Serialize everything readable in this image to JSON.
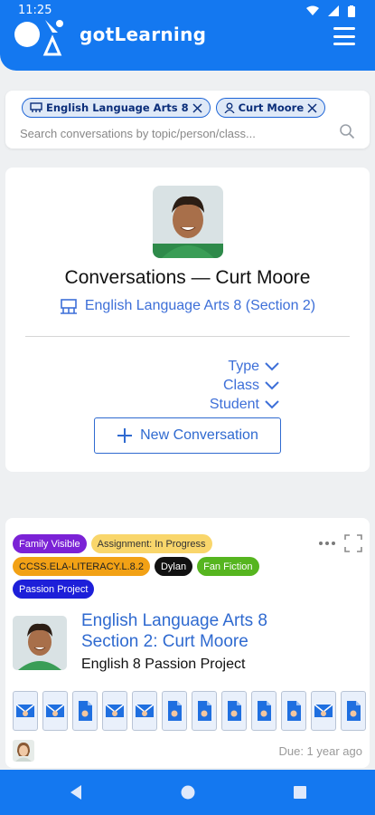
{
  "status_bar": {
    "time": "11:25"
  },
  "app": {
    "brand": "gotLearning"
  },
  "search": {
    "chips": [
      {
        "label": "English Language Arts 8",
        "icon": "classroom-icon"
      },
      {
        "label": "Curt Moore",
        "icon": "person-icon"
      }
    ],
    "placeholder": "Search conversations by topic/person/class..."
  },
  "header_card": {
    "title": "Conversations — Curt Moore",
    "class_link": "English Language Arts 8 (Section 2)",
    "filters": [
      "Type",
      "Class",
      "Student"
    ],
    "new_conversation_label": "New Conversation"
  },
  "conversation": {
    "tags": [
      {
        "label": "Family Visible",
        "bg": "#7b22d6",
        "fg": "#ffffff"
      },
      {
        "label": "Assignment: In Progress",
        "bg": "#f9d66b",
        "fg": "#333333"
      },
      {
        "label": "CCSS.ELA-LITERACY.L.8.2",
        "bg": "#f2a115",
        "fg": "#222222"
      },
      {
        "label": "Dylan",
        "bg": "#111111",
        "fg": "#ffffff"
      },
      {
        "label": "Fan Fiction",
        "bg": "#56b51f",
        "fg": "#ffffff"
      },
      {
        "label": "Passion Project",
        "bg": "#1d1fd9",
        "fg": "#ffffff"
      }
    ],
    "title_line1": "English Language Arts 8",
    "title_line2": "Section 2: Curt Moore",
    "subtitle": "English 8 Passion Project",
    "due": "Due: 1 year ago",
    "attachments": [
      "email",
      "email",
      "document",
      "email",
      "email",
      "document",
      "document",
      "document",
      "document",
      "document",
      "email",
      "document"
    ]
  },
  "colors": {
    "primary": "#1478f0",
    "link": "#2f6ad0"
  }
}
